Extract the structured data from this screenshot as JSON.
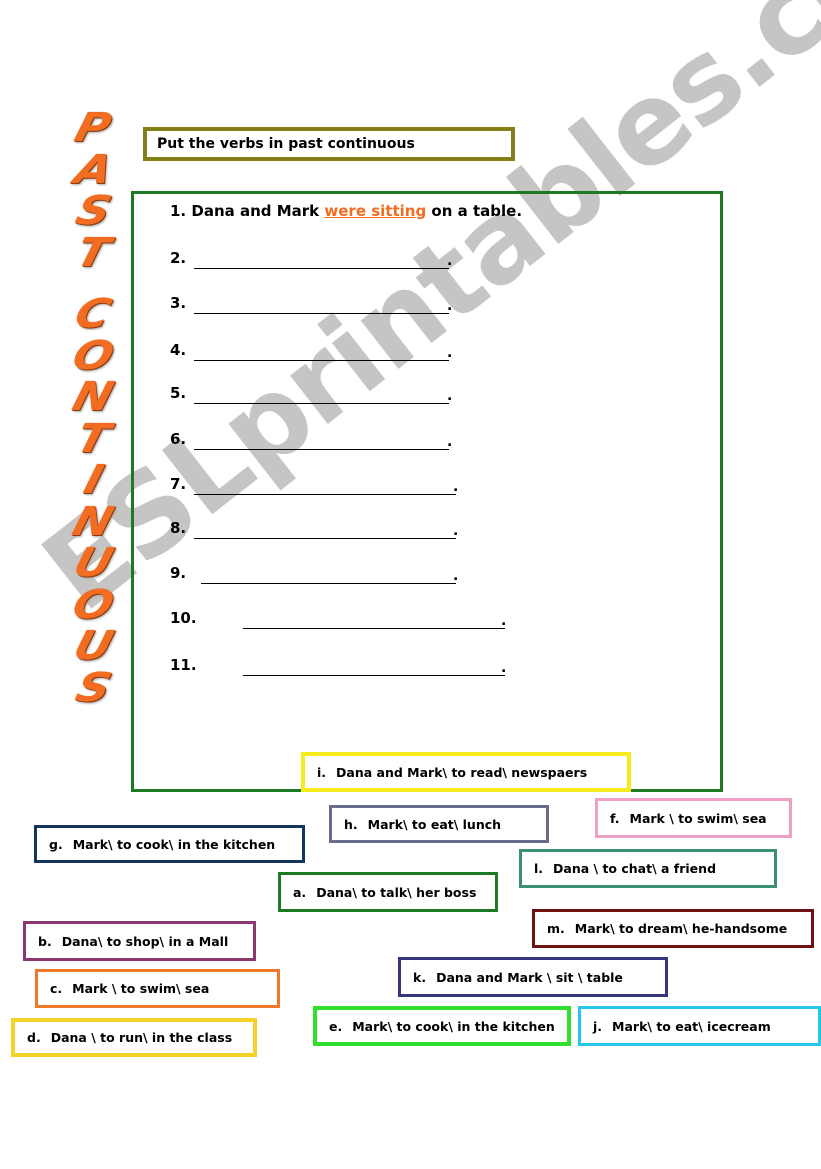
{
  "title_vertical": [
    "P",
    "A",
    "S",
    "T",
    "",
    "C",
    "O",
    "N",
    "T",
    "I",
    "N",
    "U",
    "O",
    "U",
    "S"
  ],
  "instruction": "Put the verbs in past continuous",
  "example": {
    "number": "1.",
    "before": "Dana and Mark",
    "answer": "were sitting",
    "after": "on a table."
  },
  "blanks": [
    "2.",
    "3.",
    "4.",
    "5.",
    "6.",
    "7.",
    "8.",
    "9.",
    "10.",
    "11."
  ],
  "cards": [
    {
      "letter": "i.",
      "text": "Dana and Mark\\ to read\\ newspaers",
      "color": "#f5eb1e"
    },
    {
      "letter": "h.",
      "text": "Mark\\ to eat\\ lunch",
      "color": "#6b6b8c"
    },
    {
      "letter": "f.",
      "text": "Mark \\ to swim\\ sea",
      "color": "#ee9fc4"
    },
    {
      "letter": "g.",
      "text": "Mark\\ to cook\\ in the kitchen",
      "color": "#14355c"
    },
    {
      "letter": "l.",
      "text": "Dana \\ to chat\\ a friend",
      "color": "#3c9070"
    },
    {
      "letter": "a.",
      "text": "Dana\\ to talk\\ her boss",
      "color": "#1d7a24"
    },
    {
      "letter": "m.",
      "text": "Mark\\ to dream\\ he-handsome",
      "color": "#6e0f12"
    },
    {
      "letter": "b.",
      "text": "Dana\\ to shop\\ in a Mall",
      "color": "#8a3a6e"
    },
    {
      "letter": "k.",
      "text": "Dana and Mark \\ sit \\ table",
      "color": "#36357a"
    },
    {
      "letter": "c.",
      "text": "Mark \\ to swim\\ sea",
      "color": "#f0782a"
    },
    {
      "letter": "d.",
      "text": "Dana \\ to run\\ in the class",
      "color": "#f5d22a"
    },
    {
      "letter": "e.",
      "text": "Mark\\ to cook\\ in the kitchen",
      "color": "#2fe02f"
    },
    {
      "letter": "j.",
      "text": "Mark\\ to eat\\ icecream",
      "color": "#27c4ec"
    }
  ],
  "watermark": "ESLprintables.com"
}
